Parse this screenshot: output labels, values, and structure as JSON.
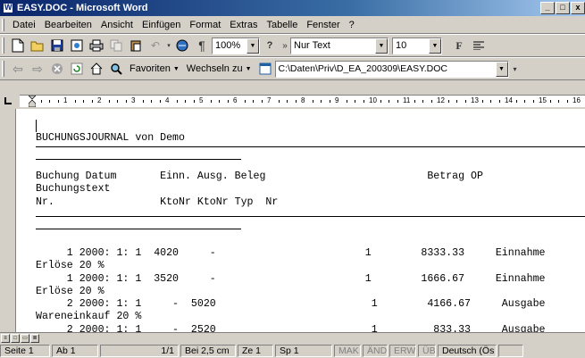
{
  "window": {
    "title": "EASY.DOC - Microsoft Word",
    "minimize": "_",
    "maximize": "□",
    "close": "x"
  },
  "menu": [
    {
      "label": "Datei"
    },
    {
      "label": "Bearbeiten"
    },
    {
      "label": "Ansicht"
    },
    {
      "label": "Einfügen"
    },
    {
      "label": "Format"
    },
    {
      "label": "Extras"
    },
    {
      "label": "Tabelle"
    },
    {
      "label": "Fenster"
    },
    {
      "label": "?"
    }
  ],
  "toolbar": {
    "zoom": "100%",
    "style": "Nur Text",
    "font_size": "10",
    "bold": "F",
    "pilcrow": "¶",
    "favorites_label": "Favoriten",
    "goto_label": "Wechseln zu",
    "address": "C:\\Daten\\Priv\\D_EA_200309\\EASY.DOC"
  },
  "ruler": {
    "labels": [
      "1",
      "2",
      "3",
      "4",
      "5",
      "6",
      "7",
      "8",
      "9",
      "10",
      "11",
      "12",
      "13",
      "14",
      "15",
      "16"
    ]
  },
  "document": {
    "title": "BUCHUNGSJOURNAL von Demo",
    "header1": "Buchung Datum       Einn. Ausg. Beleg                          Betrag OP",
    "header2": "Buchungstext",
    "header3": "Nr.                 KtoNr KtoNr Typ  Nr",
    "rows": [
      "     1 2000: 1: 1  4020     -                        1        8333.33     Einnahme",
      "Erlöse 20 %",
      "     1 2000: 1: 1  3520     -                        1        1666.67     Einnahme",
      "Erlöse 20 %",
      "     2 2000: 1: 1     -  5020                         1        4166.67     Ausgabe",
      "Wareneinkauf 20 %",
      "     2 2000: 1: 1     -  2520                         1         833.33     Ausgabe"
    ]
  },
  "status": {
    "page": "Seite 1",
    "section": "Ab 1",
    "pages": "1/1",
    "position": "Bei 2,5 cm",
    "line": "Ze 1",
    "column": "Sp 1",
    "mak": "MAK",
    "and": "ÄND",
    "erw": "ERW",
    "ub": "ÜB",
    "language": "Deutsch (Ös"
  }
}
